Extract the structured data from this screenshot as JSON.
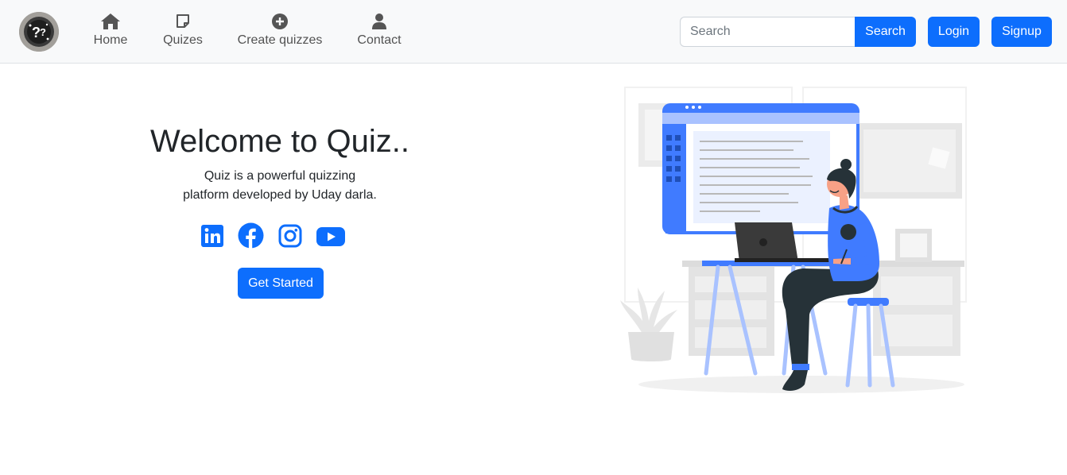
{
  "navbar": {
    "logo_icon": "quiz-question-mark-logo",
    "items": [
      {
        "label": "Home",
        "icon": "home-icon"
      },
      {
        "label": "Quizes",
        "icon": "sticky-note-icon"
      },
      {
        "label": "Create quizzes",
        "icon": "plus-circle-icon"
      },
      {
        "label": "Contact",
        "icon": "user-icon"
      }
    ],
    "search": {
      "placeholder": "Search",
      "value": "",
      "button_label": "Search"
    },
    "login_label": "Login",
    "signup_label": "Signup"
  },
  "hero": {
    "title": "Welcome to Quiz..",
    "description_line1": "Quiz is a powerful quizzing",
    "description_line2": "platform developed by Uday darla.",
    "socials": [
      {
        "icon": "linkedin-icon"
      },
      {
        "icon": "facebook-icon"
      },
      {
        "icon": "instagram-icon"
      },
      {
        "icon": "youtube-icon"
      }
    ],
    "cta_label": "Get Started"
  },
  "colors": {
    "primary": "#0d6efd",
    "navbar_bg": "#f8f9fa",
    "nav_text": "#525252",
    "illustration_accent": "#407bff"
  }
}
